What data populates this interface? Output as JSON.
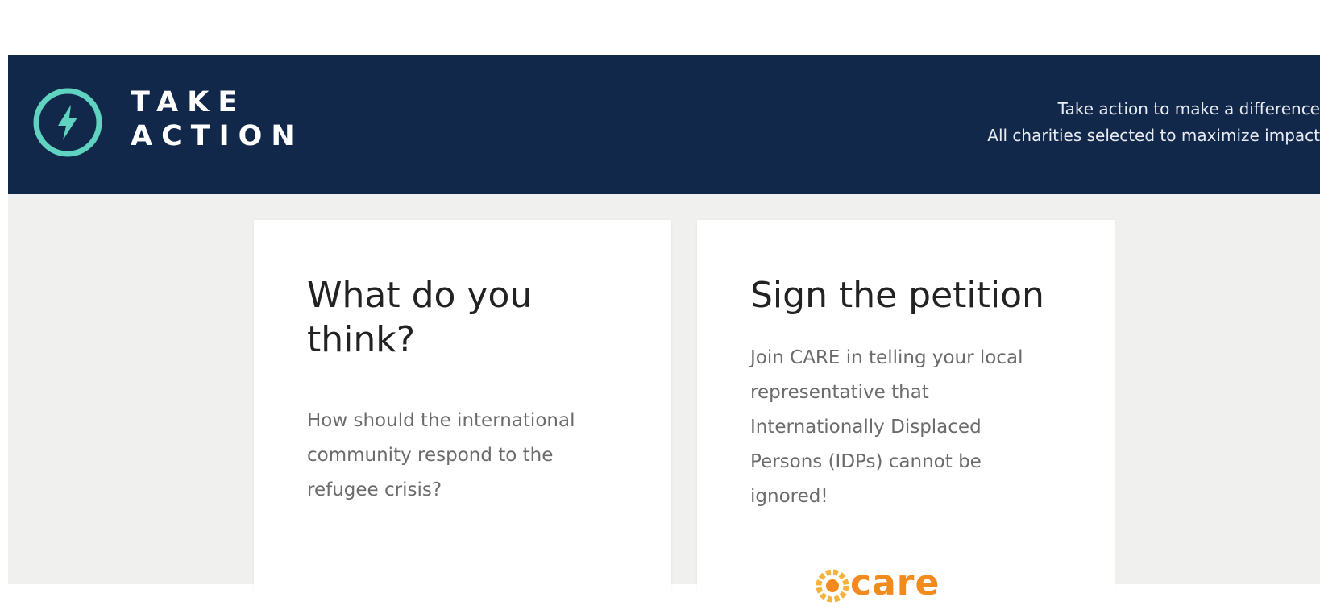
{
  "brand": {
    "name_line1": "TAKE",
    "name_line2": "ACTION",
    "icon": "lightning-bolt-icon",
    "accent_color": "#5fd3c0",
    "header_color": "#11284a"
  },
  "tagline": {
    "line1": "Take action to make a difference",
    "line2": "All charities selected to maximize impact"
  },
  "cards": [
    {
      "title": "What do you think?",
      "body": "How should the international community respond to the refugee crisis?"
    },
    {
      "title": "Sign the petition",
      "body": "Join CARE in telling your local representative that Internationally Displaced Persons (IDPs) cannot be ignored!",
      "logo_text": "care",
      "logo_color": "#f28a1e"
    }
  ]
}
